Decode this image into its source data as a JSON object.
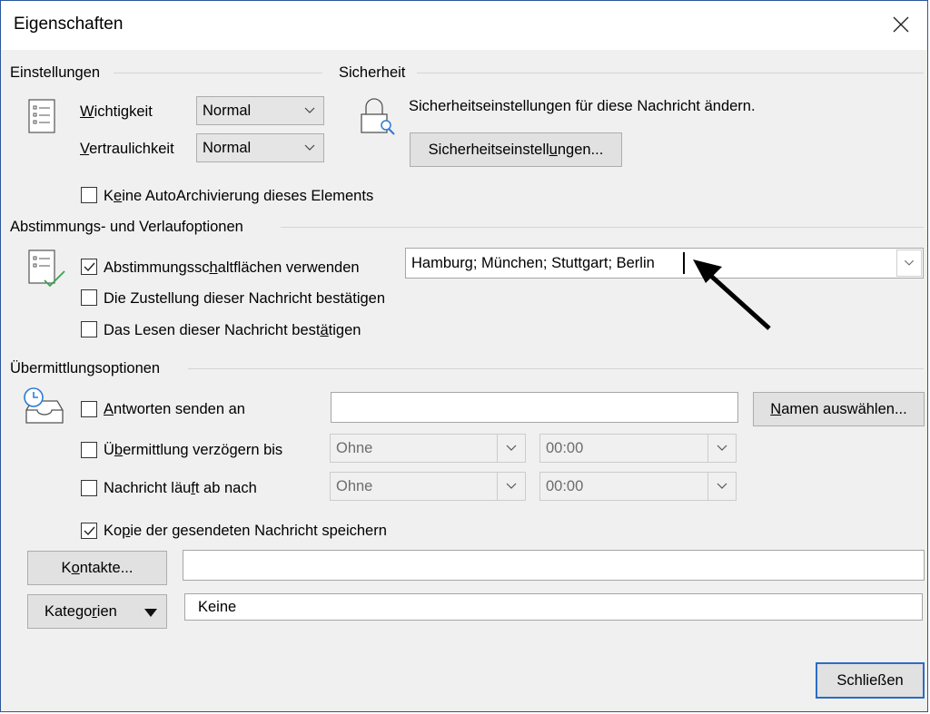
{
  "window": {
    "title": "Eigenschaften"
  },
  "einstellungen": {
    "header": "Einstellungen",
    "importance_label_u": "W",
    "importance_label_rest": "ichtigkeit",
    "importance_value": "Normal",
    "sensitivity_label_u": "V",
    "sensitivity_label_rest": "ertraulichkeit",
    "sensitivity_value": "Normal",
    "noarchive_u": "e",
    "noarchive_pre": "K",
    "noarchive_rest": "ine AutoArchivierung dieses Elements",
    "noarchive_checked": false
  },
  "sicherheit": {
    "header": "Sicherheit",
    "desc": "Sicherheitseinstellungen für diese Nachricht ändern.",
    "button_pre": "Sicherheitseinstell",
    "button_u": "u",
    "button_rest": "ngen..."
  },
  "abstimmung": {
    "header": "Abstimmungs- und Verlaufoptionen",
    "voting_pre": "Abstimmungssc",
    "voting_u": "h",
    "voting_rest": "altflächen verwenden",
    "voting_checked": true,
    "voting_value": "Hamburg; München; Stuttgart; Berlin",
    "delivery_pre": "Die Zustellun",
    "delivery_u": "g",
    "delivery_rest": " dieser Nachricht bestätigen",
    "delivery_checked": false,
    "read_pre": "Das Lesen dieser Nachricht best",
    "read_u": "ä",
    "read_rest": "tigen",
    "read_checked": false
  },
  "uebermittlung": {
    "header": "Übermittlungsoptionen",
    "reply_u": "A",
    "reply_rest": "ntworten senden an",
    "reply_checked": false,
    "reply_value": "",
    "names_button_u": "N",
    "names_button_rest": "amen auswählen...",
    "delay_pre": "Ü",
    "delay_u": "b",
    "delay_rest": "ermittlung verzögern bis",
    "delay_checked": false,
    "delay_date": "Ohne",
    "delay_time": "00:00",
    "expire_pre": "Nachricht läu",
    "expire_u": "f",
    "expire_rest": "t ab nach",
    "expire_checked": false,
    "expire_date": "Ohne",
    "expire_time": "00:00",
    "savecopy_pre": "Ko",
    "savecopy_u": "p",
    "savecopy_rest": "ie der gesendeten Nachricht speichern",
    "savecopy_checked": true
  },
  "kontakte": {
    "button_pre": "K",
    "button_u": "o",
    "button_rest": "ntakte...",
    "value": ""
  },
  "kategorien": {
    "button_pre": "Katego",
    "button_u": "r",
    "button_rest": "ien",
    "value": "Keine"
  },
  "footer": {
    "close_label": "Schließen"
  },
  "colors": {
    "accent": "#2b6dc4",
    "dialog_bg": "#f0f0f0",
    "border": "#2b579a"
  }
}
